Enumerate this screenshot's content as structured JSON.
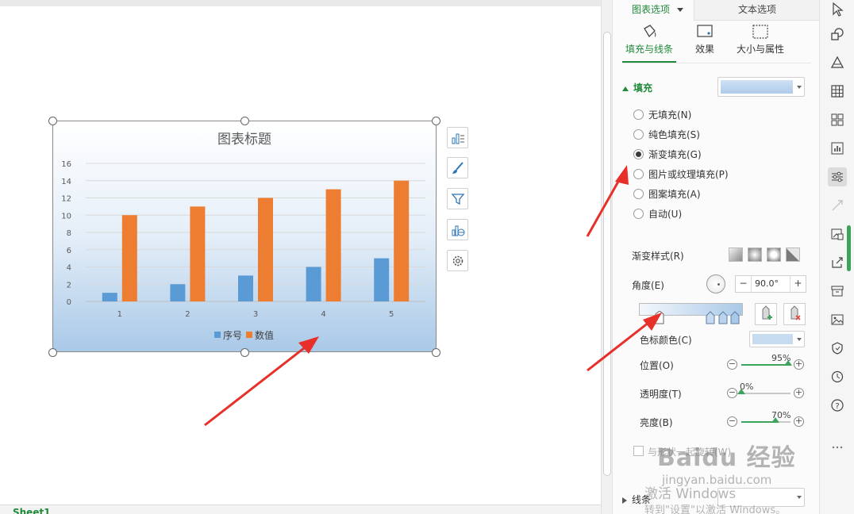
{
  "chart_data": {
    "type": "bar",
    "title": "图表标题",
    "categories": [
      "1",
      "2",
      "3",
      "4",
      "5"
    ],
    "series": [
      {
        "name": "序号",
        "values": [
          1,
          2,
          3,
          4,
          5
        ],
        "color": "#5b9bd5"
      },
      {
        "name": "数值",
        "values": [
          10,
          11,
          12,
          13,
          14
        ],
        "color": "#ed7d31"
      }
    ],
    "ylim": [
      0,
      16
    ],
    "yticks": [
      "0",
      "2",
      "4",
      "6",
      "8",
      "10",
      "12",
      "14",
      "16"
    ],
    "grid": true,
    "legend_position": "bottom",
    "background": "gradient light-to-blue"
  },
  "sheet": {
    "tab": "Sheet1"
  },
  "pane": {
    "tabs": {
      "chart_options": "图表选项",
      "text_options": "文本选项"
    },
    "subtabs": [
      "填充与线条",
      "效果",
      "大小与属性"
    ],
    "fill_section": "填充",
    "fill_options": [
      "无填充(N)",
      "纯色填充(S)",
      "渐变填充(G)",
      "图片或纹理填充(P)",
      "图案填充(A)",
      "自动(U)"
    ],
    "selected_fill": "渐变填充(G)",
    "gradient_style_label": "渐变样式(R)",
    "angle_label": "角度(E)",
    "angle_value": "90.0°",
    "stop_color_label": "色标颜色(C)",
    "position_label": "位置(O)",
    "position_value": "95%",
    "position_fraction": 0.95,
    "transparency_label": "透明度(T)",
    "transparency_value": "0%",
    "transparency_fraction": 0.0,
    "brightness_label": "亮度(B)",
    "brightness_value": "70%",
    "brightness_fraction": 0.7,
    "rotate_with_shape": "与形状一起旋转(W)",
    "line_section": "线条"
  },
  "watermark": {
    "brand": "Baidu 经验",
    "url": "jingyan.baidu.com",
    "activate_line1": "激活 Windows",
    "activate_line2": "转到\"设置\"以激活 Windows。"
  },
  "colors": {
    "accent": "#1f8a3a",
    "arrow": "#e8302a"
  }
}
